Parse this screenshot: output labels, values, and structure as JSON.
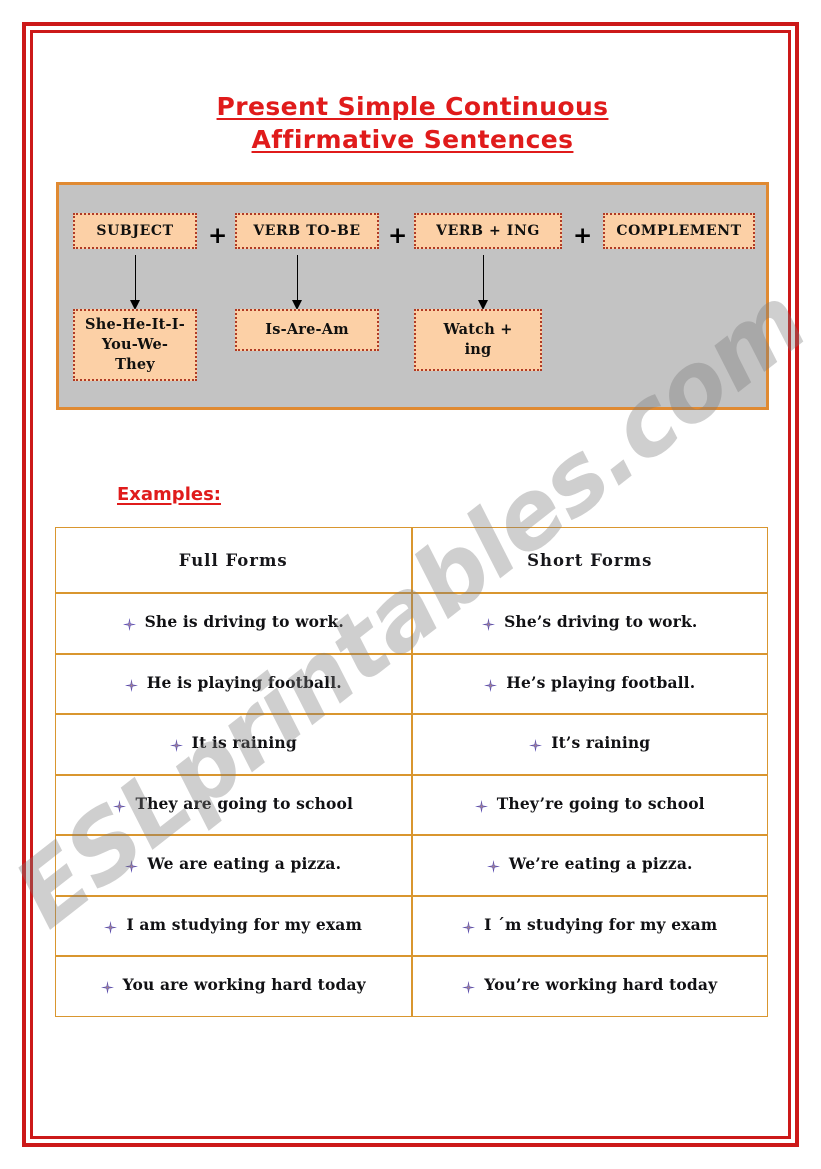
{
  "document": {
    "title_lines": [
      "Present Simple Continuous",
      "Affirmative Sentences"
    ],
    "title_color": "#e01b1b",
    "frame_color": "#cc1919"
  },
  "watermark": {
    "text": "ESLprintables.com"
  },
  "formula": {
    "panel_bg": "#c3c3c3",
    "panel_border": "#e08a32",
    "box_fill": "#fcd0a6",
    "box_border": "#b03a25",
    "operators": [
      "+",
      "+",
      "+"
    ],
    "top_boxes": [
      {
        "label": "SUBJECT"
      },
      {
        "label": "VERB TO-BE"
      },
      {
        "label": "VERB + ING"
      },
      {
        "label": "COMPLEMENT"
      }
    ],
    "bottom_boxes": [
      {
        "label": "She-He-It-I-\nYou-We-\nThey"
      },
      {
        "label": "Is-Are-Am"
      },
      {
        "label": "Watch +\ning"
      }
    ]
  },
  "examples": {
    "heading": "Examples:",
    "heading_color": "#e01b1b",
    "table_border_color": "#d9962f",
    "bullet_icon": "star-bullet-icon",
    "columns": [
      "Full Forms",
      "Short Forms"
    ],
    "rows": [
      {
        "full": "She is driving to work.",
        "short": "She’s driving to work."
      },
      {
        "full": "He is playing football.",
        "short": "He’s playing football."
      },
      {
        "full": "It is raining",
        "short": "It’s raining"
      },
      {
        "full": "They are going to school",
        "short": "They’re going to school"
      },
      {
        "full": "We are eating a pizza.",
        "short": "We’re eating a pizza."
      },
      {
        "full": "I am studying for my exam",
        "short": "I ´m studying for my exam"
      },
      {
        "full": "You are working hard today",
        "short": "You’re working hard today"
      }
    ]
  }
}
